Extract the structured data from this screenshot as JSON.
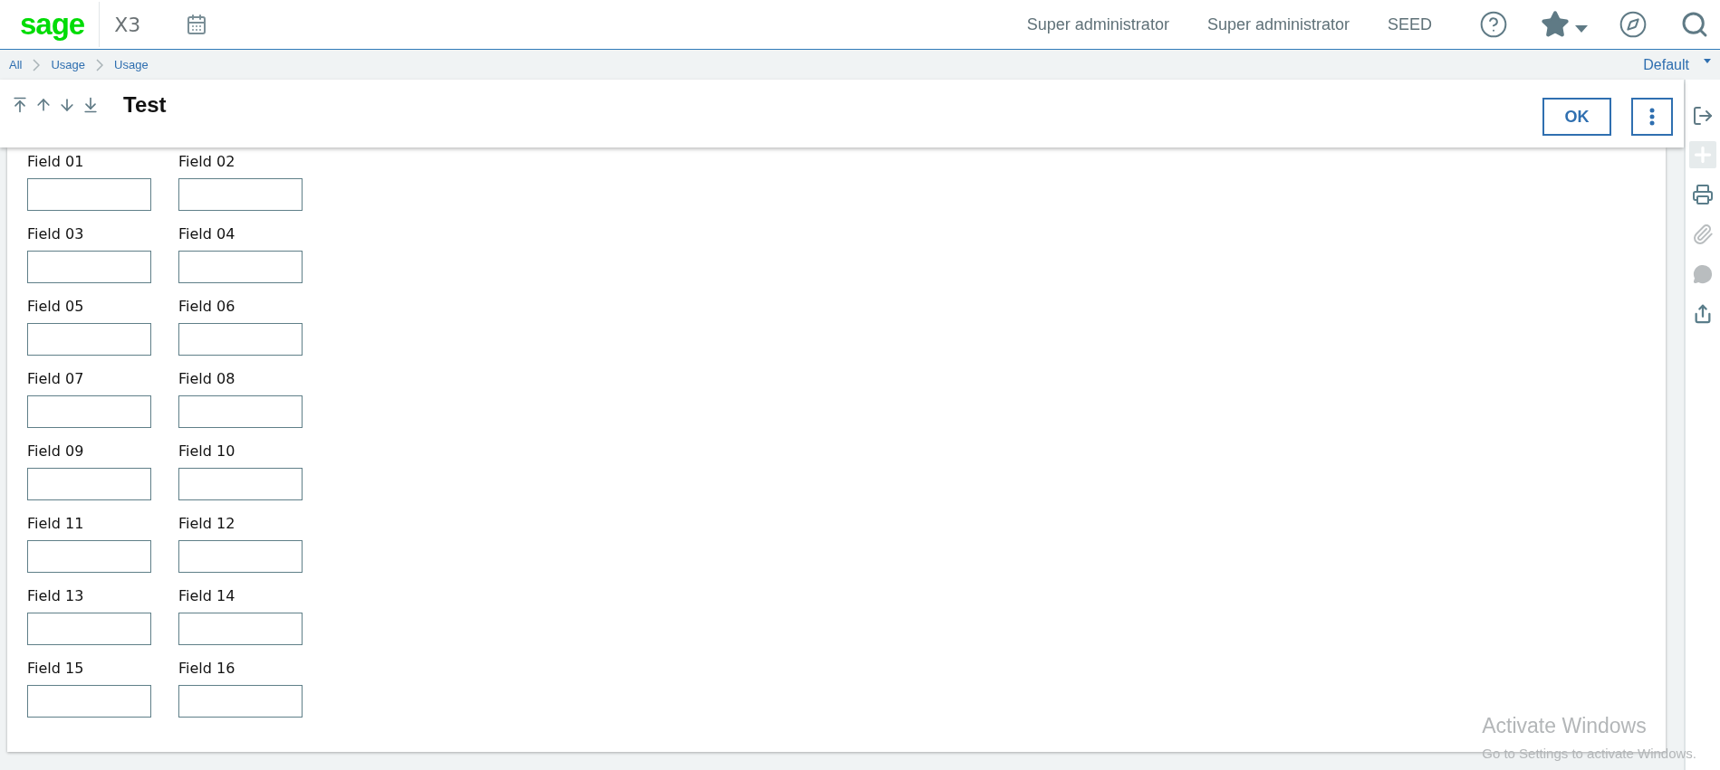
{
  "top_bar": {
    "logo": "sage",
    "product": "X3",
    "user": "Super administrator",
    "role": "Super administrator",
    "folder": "SEED"
  },
  "breadcrumb": [
    {
      "label": "All"
    },
    {
      "label": "Usage"
    },
    {
      "label": "Usage"
    }
  ],
  "view_selector": "Default",
  "page": {
    "title": "Test",
    "ok_button": "OK"
  },
  "side_actions": [
    {
      "kind": "add",
      "disabled": true
    },
    {
      "kind": "print",
      "disabled": false
    },
    {
      "kind": "attach",
      "disabled": true
    },
    {
      "kind": "comment",
      "disabled": true
    },
    {
      "kind": "export",
      "disabled": false
    }
  ],
  "fields": [
    {
      "label": "Field 01"
    },
    {
      "label": "Field 02"
    },
    {
      "label": "Field 03"
    },
    {
      "label": "Field 04"
    },
    {
      "label": "Field 05"
    },
    {
      "label": "Field 06"
    },
    {
      "label": "Field 07"
    },
    {
      "label": "Field 08"
    },
    {
      "label": "Field 09"
    },
    {
      "label": "Field 10"
    },
    {
      "label": "Field 11"
    },
    {
      "label": "Field 12"
    },
    {
      "label": "Field 13"
    },
    {
      "label": "Field 14"
    },
    {
      "label": "Field 15"
    },
    {
      "label": "Field 16"
    }
  ],
  "os_notice": {
    "title": "Activate Windows",
    "text": "Go to Settings to activate Windows."
  }
}
